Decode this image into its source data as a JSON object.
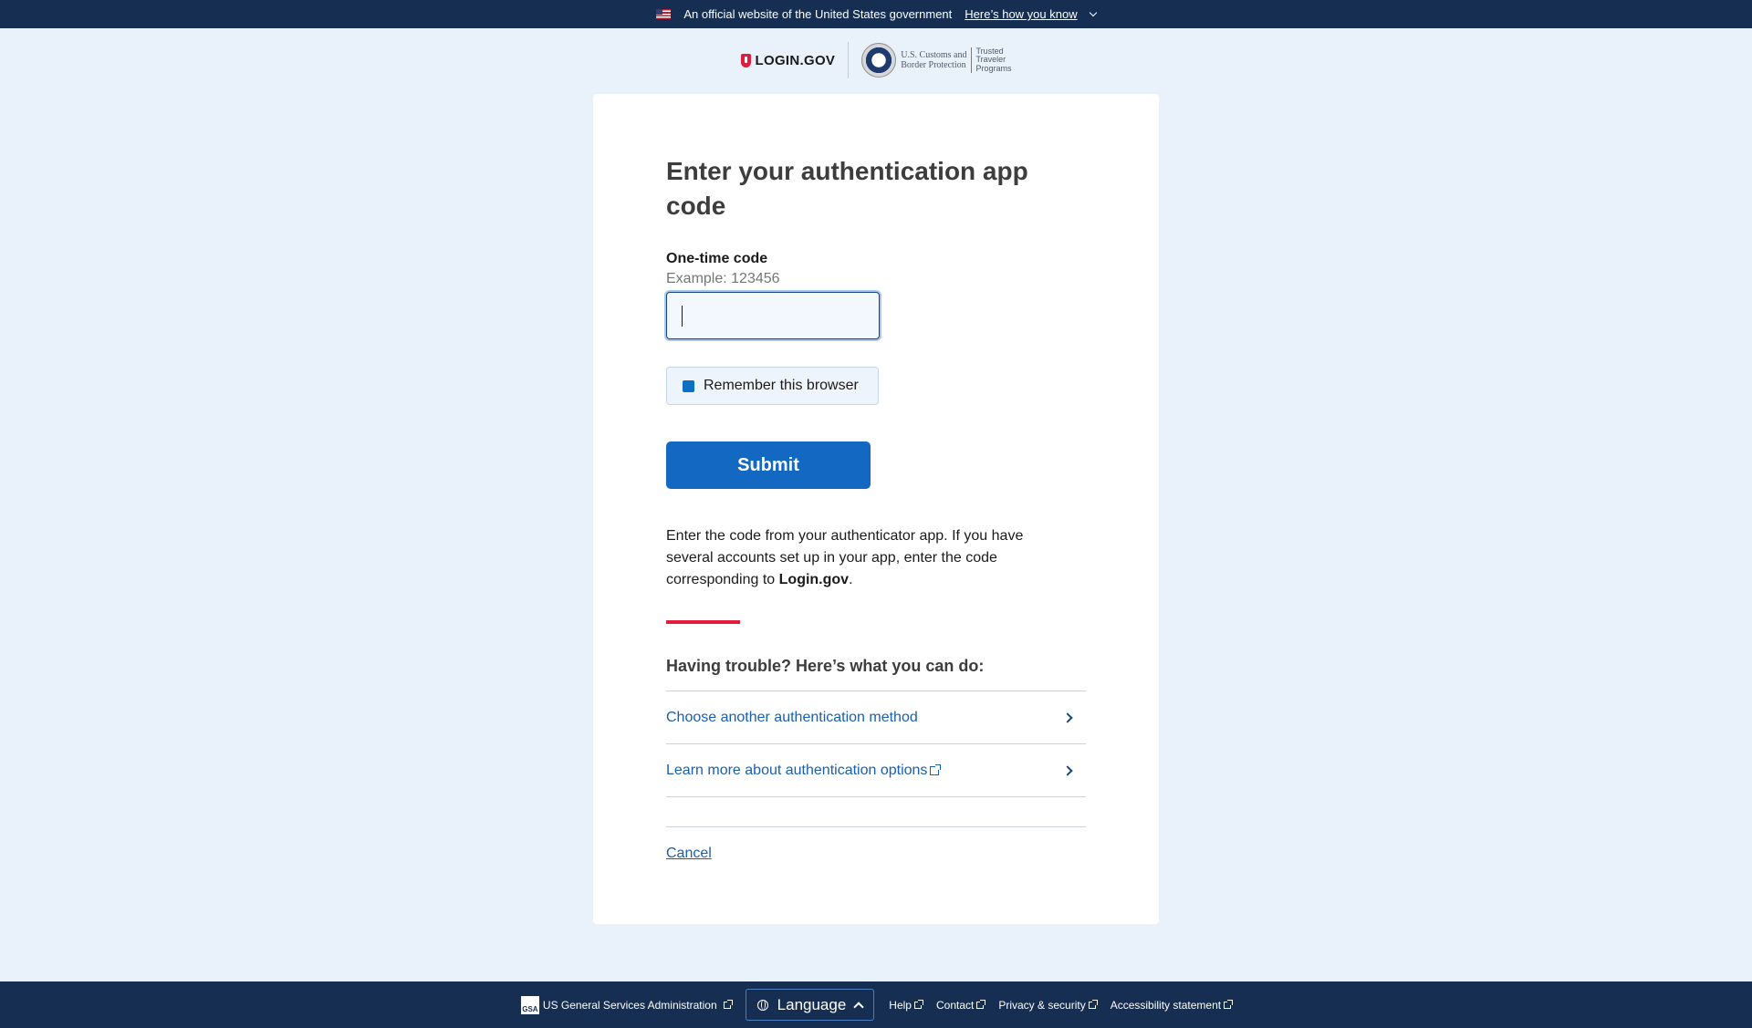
{
  "banner": {
    "official_text": "An official website of the United States government",
    "how_text": "Here’s how you know"
  },
  "header": {
    "logo_text": "LOGIN.GOV",
    "cbp_line1": "U.S. Customs and",
    "cbp_line2": "Border Protection",
    "ttp_line1": "Trusted",
    "ttp_line2": "Traveler",
    "ttp_line3": "Programs"
  },
  "form": {
    "title": "Enter your authentication app code",
    "code_label": "One-time code",
    "code_hint": "Example: 123456",
    "code_value": "",
    "remember_label": "Remember this browser",
    "submit_label": "Submit",
    "instructions_part1": "Enter the code from your authenticator app. If you have several accounts set up in your app, enter the code corresponding to ",
    "instructions_bold": "Login.gov",
    "instructions_end": "."
  },
  "trouble": {
    "heading": "Having trouble? Here’s what you can do:",
    "options": [
      {
        "label": "Choose another authentication method"
      },
      {
        "label": "Learn more about authentication options"
      }
    ],
    "cancel_label": "Cancel"
  },
  "footer": {
    "gsa_icon_text": "GSA",
    "gsa_label": "US General Services Administration",
    "language_label": "Language",
    "links": [
      "Help",
      "Contact",
      "Privacy & security",
      "Accessibility statement"
    ]
  },
  "colors": {
    "banner_bg": "#162e51",
    "primary_button": "#1368c2",
    "link": "#1a5fb0",
    "accent_red": "#e21c3d",
    "page_bg": "#e9f1fa"
  }
}
